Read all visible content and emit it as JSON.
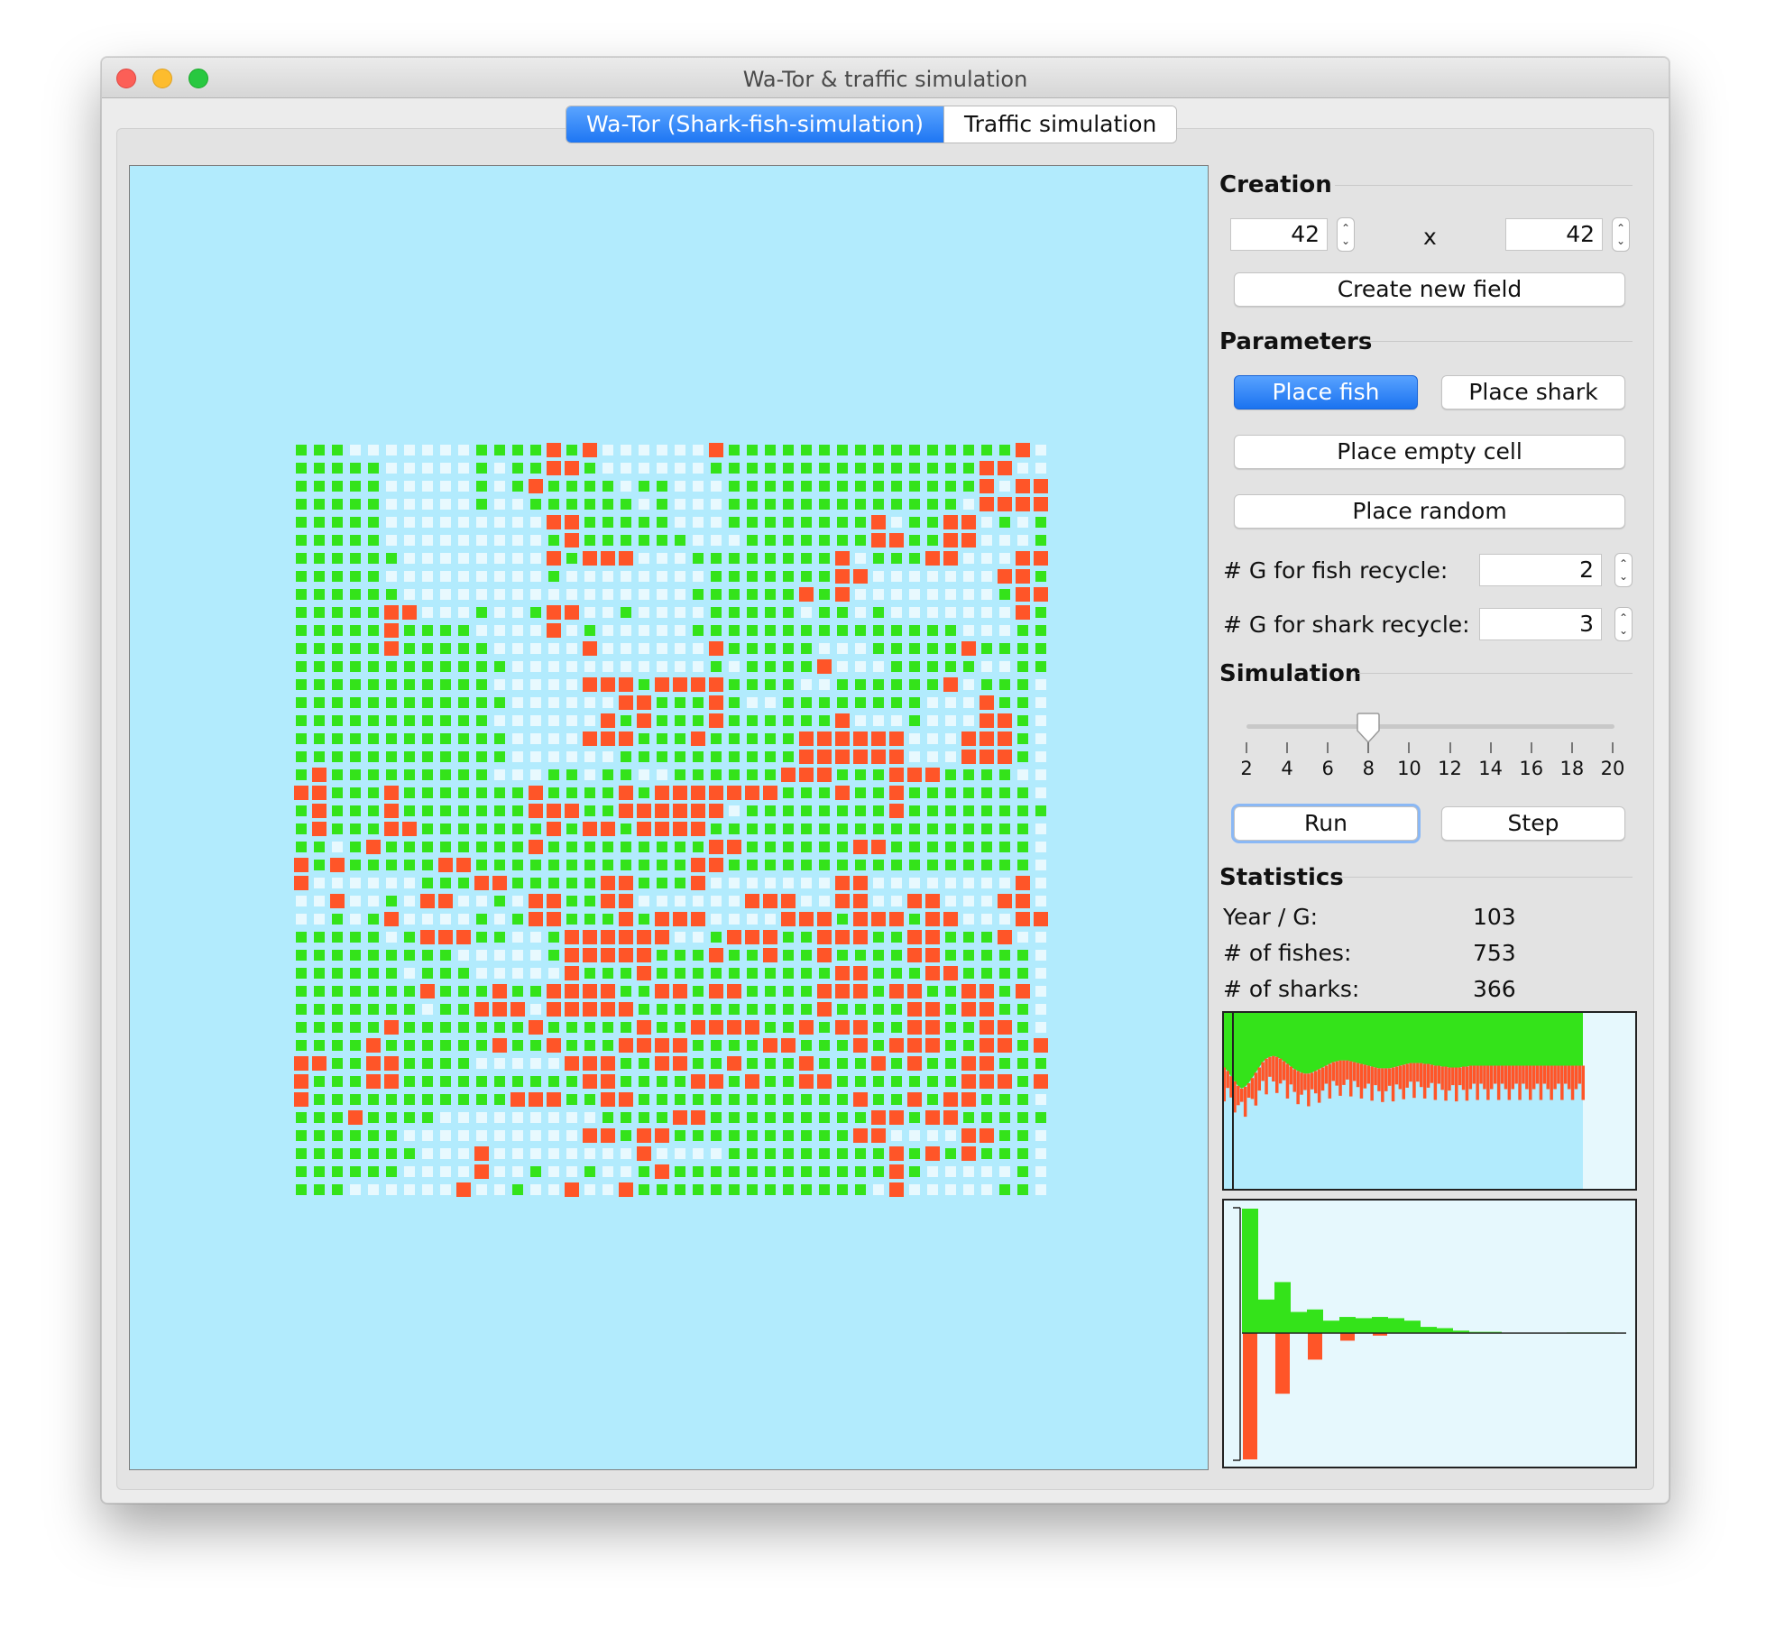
{
  "window": {
    "title": "Wa-Tor & traffic simulation"
  },
  "tabs": [
    {
      "label": "Wa-Tor (Shark-fish-simulation)",
      "active": true
    },
    {
      "label": "Traffic simulation",
      "active": false
    }
  ],
  "colors": {
    "fish": "#34e31a",
    "shark": "#ff5528",
    "empty": "#e8f9fe",
    "sea": "#b2ebfd",
    "accent": "#1e76f3"
  },
  "creation": {
    "title": "Creation",
    "width_value": "42",
    "height_value": "42",
    "separator": "x",
    "create_button": "Create new field"
  },
  "parameters": {
    "title": "Parameters",
    "place_fish": "Place fish",
    "place_shark": "Place shark",
    "place_empty": "Place empty cell",
    "place_random": "Place random",
    "fish_recycle_label": "# G for fish recycle:",
    "fish_recycle_value": "2",
    "shark_recycle_label": "# G for shark recycle:",
    "shark_recycle_value": "3"
  },
  "simulation": {
    "title": "Simulation",
    "speed_value": 8,
    "speed_min": 2,
    "speed_max": 20,
    "tick_labels": [
      "2",
      "4",
      "6",
      "8",
      "10",
      "12",
      "14",
      "16",
      "18",
      "20"
    ],
    "run_button": "Run",
    "step_button": "Step"
  },
  "statistics": {
    "title": "Statistics",
    "year_label": "Year / G:",
    "year_value": "103",
    "fishes_label": "# of fishes:",
    "fishes_value": "753",
    "sharks_label": "# of sharks:",
    "sharks_value": "366"
  },
  "grid": {
    "size": 42,
    "rows": [
      "FFFEEEEEEEFFFFSFSEEEEEESFFFFFFFFFFFFFFFFSEFF",
      "FFFFFEEEEEFEFFSSFEEEEEEFFFFFFFFFFFFFFFSSEEFF",
      "FFFFFEEEEEFEFSFFFFEFFEEEFFFFFFFFFFFFFFSESSEFF",
      "FFFFFEEEEEFEEFFFFFFEFEEEFFFFFFFFFFFFFESSSSEFF",
      "FFFFFEEEEEEEEESSFFFFFEEEFFFFFFFFSEFFSSEFEFFF",
      "FFFFFEEEEEEEEEFSFFFFFFEEEFFFFFFFSSFFSSEEEFFF",
      "FFFFFFEEEEEEEESFSSSEEEFFFFFFFFSEFFFSSEEESSF",
      "FFFFFEEEEEEEEEFEEEEEEEEFFFFFFFSSEEEEEEESSF",
      "FFFFFFEEEEEEEEEEEEEEEEFFFFFFSFSEEEEEEEEFSSF",
      "FFFFFSSEEEFEEFSSEEFEEEEFFFFFEFFEFEEEEEEESFF",
      "FFFFFSFFFFEEEESEFEEEEEFFFFFFFFFFFFFFFEEEFFF",
      "FFFFFSFFFFFEEEEESEEEEEESFFFFFEEEFFFFFSFFFFF",
      "FFFFFFFFFFFFEEEEEEEEEEEFEFFFFSEEEFFFFFEEFFF",
      "FFFFFFFFFFFEEEEESSSFSSSSFFFFEEFFFFFFSEFFF",
      "FFFFFFFFFFFFEEEEEESSFFFSFEEFFFFFFFFEEESFF",
      "FFFFFFFFFFFEEEEEESFSFFFSFFFFFFSEEEFEEESSF",
      "FFFFFFFFFFFFEEEESSSFFFSFFFFFSSSSSSEEESSSF",
      "FFFFFFFFFFFFEEEEEEFFFFFFFFFFSSSSSSEEESSSF",
      "FSFFFFFFFFFEEEFFEFFEEFFFFFFSSSFFFSSSFFFF",
      "SSFFFSFFFFFFFSFFFFSFSSSSSSSFFFSFFSFFFFFFF",
      "FSFFFSFFFFFFFSSSFFSSSSSSEFFFFFFFFSFFFFFFFF",
      "FSFFFSSFFFFFFFSFSSFSSSSFFFFFFFFFFFFFFFFFF",
      "FFEFSFFFFFFFFSFFFFFFFFFSSFFFFFFSSFFFFFFFF",
      "SFSFFFFFSSFFFFFFFFFFFFSSFFFFFFFFFFFFFFFFF",
      "SEEEEEEFFFSSFFFFFSSFFFSEEEEEEESSEEEEEEEESE",
      "EESEEFESSEEFESSFFSSEEEEEESSSEESSEESSEEESSE",
      "EEFEFSEEEEFEFSSFFFSFSSSEEEESSSFSSSFSSEEESSE",
      "FFFFFEFSSSFFEEFSSSSSSEEFSSSFFSSSFFSSFFFSE",
      "FFFFFFFFFEEEEEFSSSSSFFFSFFSFFSFFFFSSFFFFF",
      "FFFFFFEFFFEEEEESFFFSFFFFFFFFFFSSFFFSSFFFF",
      "FFFFFFFSFFFSFFSSSSFFSSFSSFFFFSSSFSSFFSSFS",
      "FFFFFFFEFFSSSESSSSSFFFFFFFFFFSFFFFSSFSSFF",
      "FFFFFSFFFFFFFSFFFFFSFFSSSSFFSFSSFFSSFFSSF",
      "FFFFSFFFFFFSFFSFFFSSSSFFFFSSFFFSFSSSFFSSFS",
      "SSFFSSFFFFEEEEESSSFFSSFFSFFFSFFFSFSFFSSFFF",
      "SFFFSSFFFFFFFFFFSSFFFFSSFSFFSSFFFFFFFSSSFS",
      "SFFFFFFFFFFFSSSFFSSFFFFFFFFFFFFSFFSFSSFFF",
      "FFFSFFFFEEEEEEEEEFFFFSSFFFFFFFFFSSFSSFFFFFF",
      "FFFFFFEEEEEEEEEESSFSSFFFFFFFFFFSSEEEESSFF",
      "FFFFFFFEEESEEEEEEEESEEEEFFFFFFFFFSFSFSFFF",
      "FFFFFFEEEESEEFEEFEEFSFFFFFFFFFFFFSFEEEEEF",
      "FFFEEEEEESEEFEESEESFFFFFFFFFFFFFESEEEEEFF"
    ]
  },
  "population_chart": {
    "generations": 103,
    "fish_fraction": "above shark curve to top",
    "shark_series": [
      0.62,
      0.66,
      0.72,
      0.78,
      0.83,
      0.86,
      0.84,
      0.8,
      0.74,
      0.68,
      0.62,
      0.56,
      0.52,
      0.5,
      0.49,
      0.5,
      0.52,
      0.55,
      0.58,
      0.61,
      0.64,
      0.66,
      0.68,
      0.69,
      0.69,
      0.68,
      0.66,
      0.64,
      0.62,
      0.6,
      0.58,
      0.56,
      0.55,
      0.54,
      0.54,
      0.54,
      0.55,
      0.56,
      0.57,
      0.58,
      0.59,
      0.6,
      0.61,
      0.62,
      0.63,
      0.63,
      0.63,
      0.63,
      0.62,
      0.61,
      0.6,
      0.59,
      0.58,
      0.57,
      0.57,
      0.57,
      0.57,
      0.58,
      0.58,
      0.59,
      0.6,
      0.6,
      0.61,
      0.61,
      0.62,
      0.62,
      0.62,
      0.62,
      0.61,
      0.61,
      0.6,
      0.6,
      0.6,
      0.6,
      0.6,
      0.6,
      0.6,
      0.6,
      0.6,
      0.6,
      0.6,
      0.6,
      0.6,
      0.6,
      0.6,
      0.6,
      0.6,
      0.6,
      0.6,
      0.6,
      0.6,
      0.6,
      0.6,
      0.6,
      0.6,
      0.6,
      0.6,
      0.6,
      0.6,
      0.6,
      0.6,
      0.6,
      0.6
    ]
  },
  "histogram_chart": {
    "fish_values": [
      1.0,
      0.27,
      0.41,
      0.17,
      0.19,
      0.1,
      0.13,
      0.12,
      0.13,
      0.12,
      0.1,
      0.05,
      0.04,
      0.02,
      0.01,
      0.01,
      0,
      0,
      0,
      0,
      0.005,
      0.005,
      0.005
    ],
    "shark_values": [
      1.0,
      0,
      0.48,
      0,
      0.21,
      0,
      0.06,
      0,
      0.02,
      0
    ]
  }
}
